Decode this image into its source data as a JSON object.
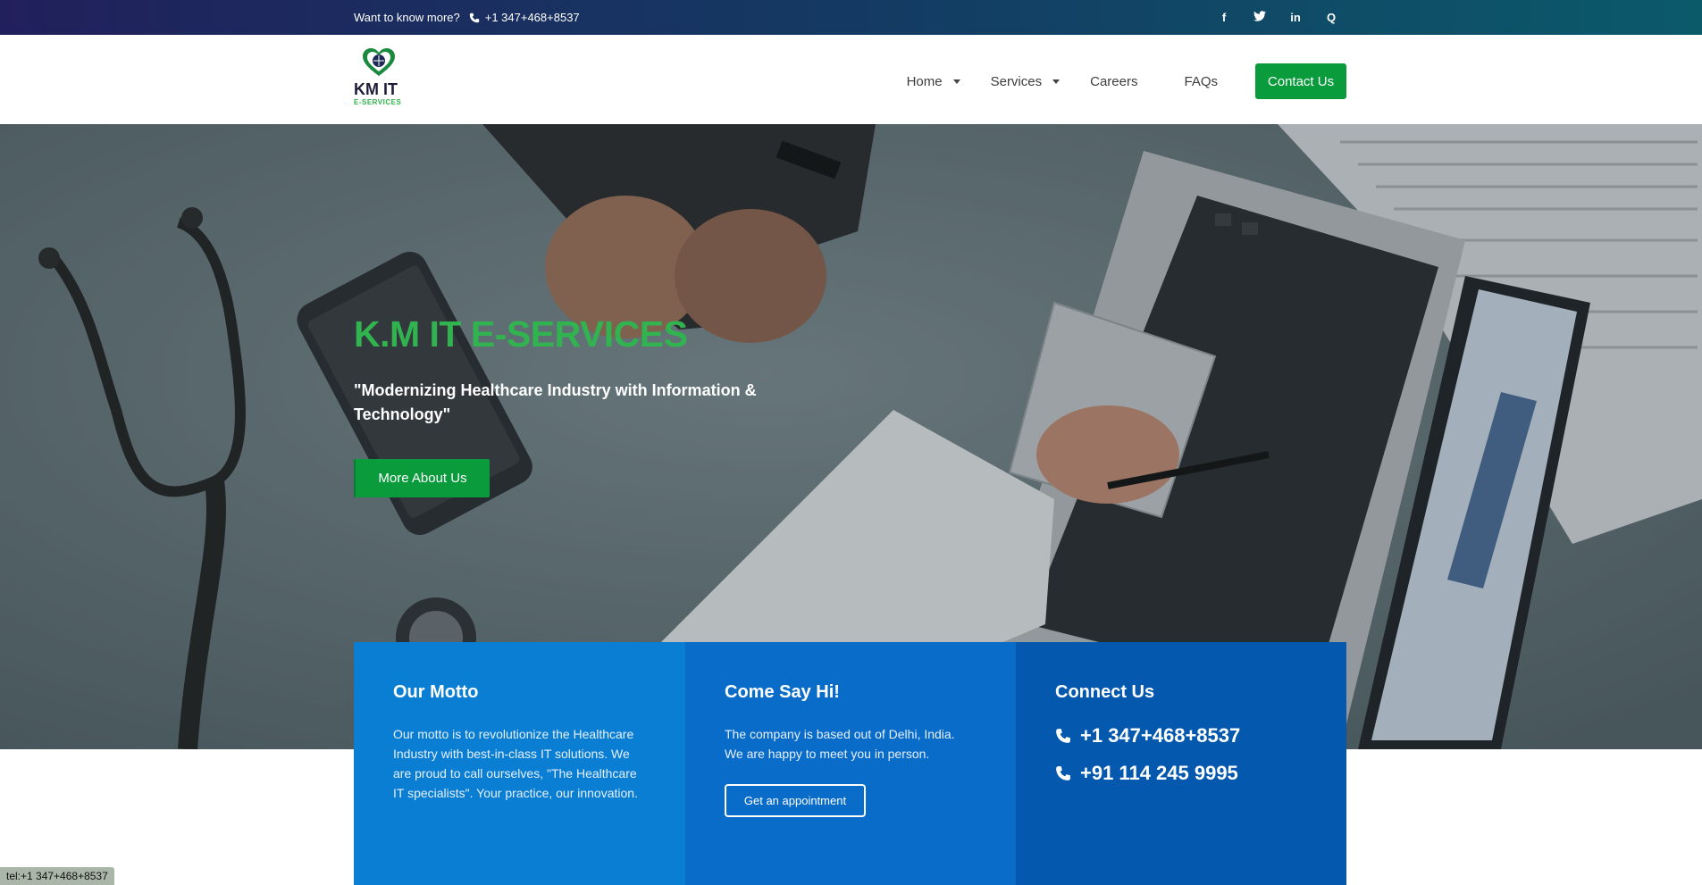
{
  "topbar": {
    "tagline": "Want to know more?",
    "phone": "+1 347+468+8537",
    "social": [
      {
        "icon": "facebook-icon",
        "glyph": "f"
      },
      {
        "icon": "twitter-icon",
        "glyph": "t"
      },
      {
        "icon": "linkedin-icon",
        "glyph": "in"
      },
      {
        "icon": "search-icon",
        "glyph": "Q"
      }
    ]
  },
  "header": {
    "logo_line1": "KM IT",
    "logo_line2": "E-SERVICES",
    "nav": [
      {
        "label": "Home",
        "dropdown": true
      },
      {
        "label": "Services",
        "dropdown": true
      },
      {
        "label": "Careers",
        "dropdown": false
      },
      {
        "label": "FAQs",
        "dropdown": false
      }
    ],
    "cta": "Contact Us"
  },
  "hero": {
    "title": "K.M IT E-SERVICES",
    "subtitle": "\"Modernizing Healthcare Industry with Information & Technology\"",
    "button": "More About Us"
  },
  "cards": {
    "motto": {
      "title": "Our Motto",
      "text": "Our motto is to revolutionize the Healthcare Industry with best-in-class IT solutions. We are proud to call ourselves, \"The Healthcare IT specialists\". Your practice, our innovation."
    },
    "hi": {
      "title": "Come Say Hi!",
      "text": "The company is based out of Delhi, India. We are happy to meet you in person.",
      "button": "Get an appointment"
    },
    "connect": {
      "title": "Connect Us",
      "phones": [
        "+1 347+468+8537",
        "+91 114 245 9995"
      ]
    }
  },
  "status_bar": "tel:+1 347+468+8537",
  "colors": {
    "accent_green": "#0a9b3d",
    "title_green": "#31b34f",
    "card_blue_1": "#0a7ed3",
    "card_blue_2": "#0a6cc9",
    "card_blue_3": "#0458ad"
  }
}
